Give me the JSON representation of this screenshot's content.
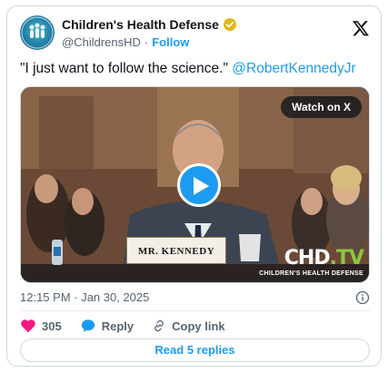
{
  "author": {
    "display_name": "Children's Health Defense",
    "handle": "@ChildrensHD",
    "separator": "·",
    "follow_label": "Follow",
    "verified_color": "#e2b719"
  },
  "tweet": {
    "text": "\"I just want to follow the science.\"",
    "mention": "@RobertKennedyJr",
    "timestamp": "12:15 PM · Jan 30, 2025"
  },
  "media": {
    "watch_label": "Watch on X",
    "name_plate": "MR. KENNEDY",
    "logo_main_left": "CHD",
    "logo_main_dot": ".",
    "logo_main_right": "TV",
    "logo_sub": "CHILDREN'S HEALTH DEFENSE"
  },
  "actions": {
    "like_count": "305",
    "reply_label": "Reply",
    "copy_link_label": "Copy link"
  },
  "footer": {
    "read_replies_label": "Read 5 replies"
  },
  "colors": {
    "accent": "#1d9bf0",
    "like": "#f91880",
    "text_secondary": "#536471"
  },
  "icons": [
    "verified-icon",
    "x-logo-icon",
    "play-icon",
    "info-icon",
    "heart-icon",
    "reply-icon",
    "link-icon"
  ]
}
